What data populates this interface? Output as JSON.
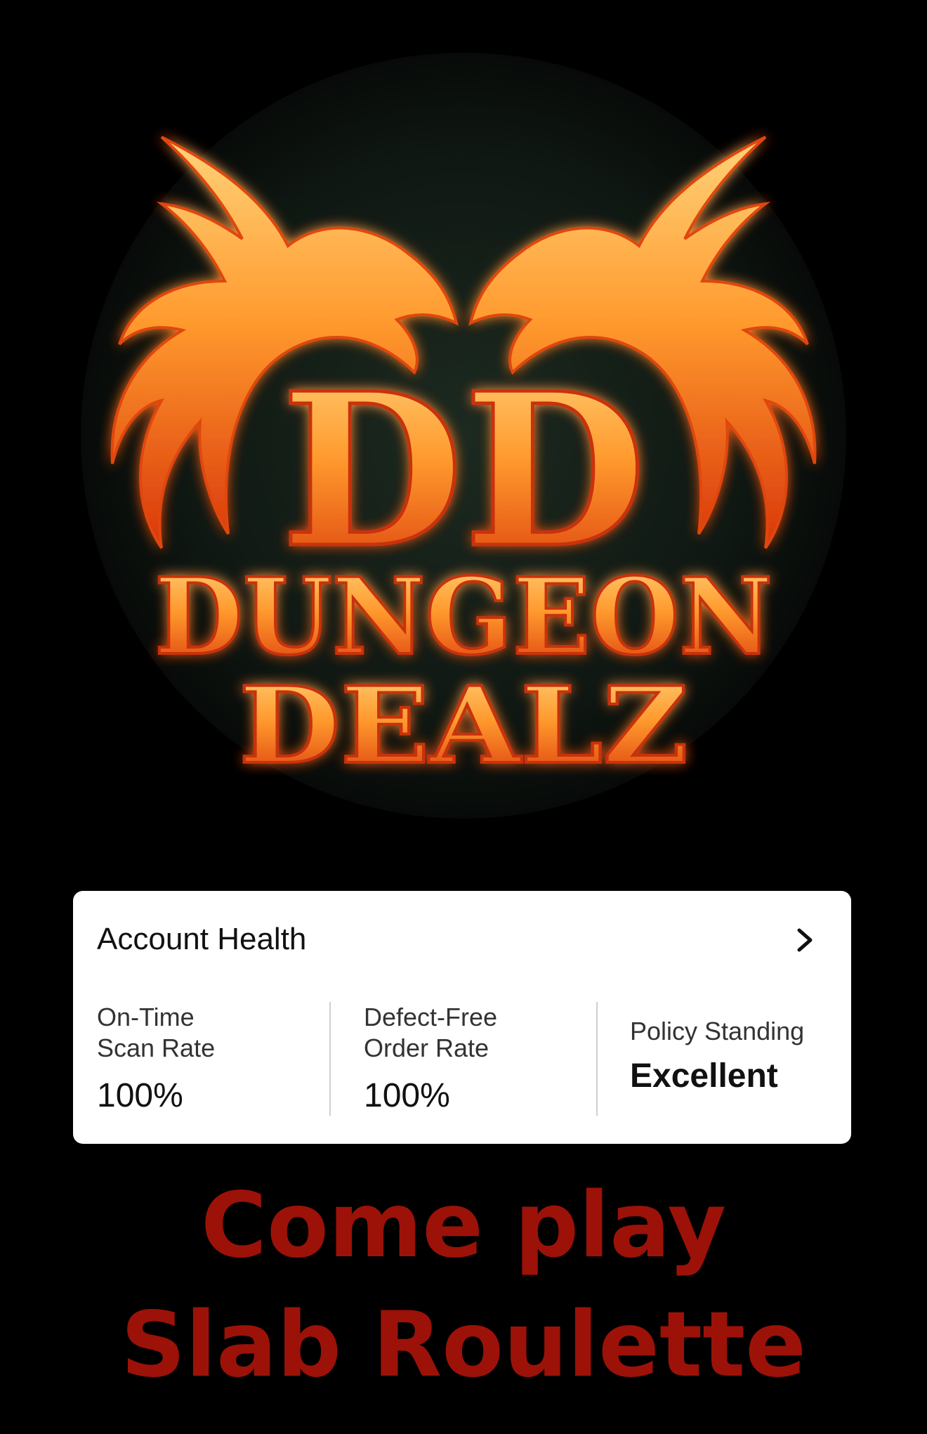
{
  "logo": {
    "monogram": "DD",
    "line1": "DUNGEON",
    "line2": "DEALZ"
  },
  "account_health": {
    "title": "Account Health",
    "metrics": [
      {
        "label": "On-Time\nScan Rate",
        "value": "100%"
      },
      {
        "label": "Defect-Free\nOrder Rate",
        "value": "100%"
      },
      {
        "label": "Policy Standing",
        "value": "Excellent"
      }
    ]
  },
  "caption": {
    "line1": "Come play",
    "line2": "Slab Roulette"
  },
  "colors": {
    "background": "#000000",
    "logo_circle": "#0f1712",
    "flame_outer": "#d9360a",
    "flame_inner": "#ffb347",
    "caption": "#9c1208",
    "card": "#ffffff"
  }
}
